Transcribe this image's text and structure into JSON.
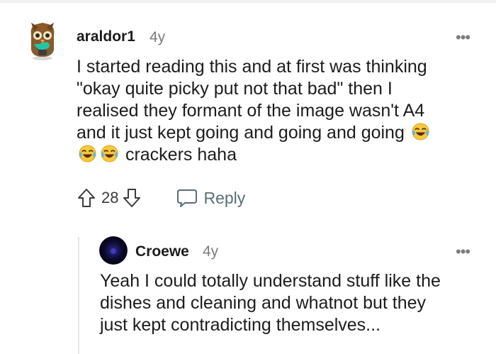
{
  "comments": [
    {
      "username": "araldor1",
      "age": "4y",
      "lines": [
        "I started reading this and at first was thinking",
        "\"okay quite picky put not that bad\" then I",
        "realised they formant of the image wasn't A4",
        "and it just kept going and going and going",
        "crackers haha"
      ],
      "votes": "28",
      "reply_label": "Reply",
      "more_label": "•••"
    },
    {
      "username": "Croewe",
      "age": "4y",
      "lines": [
        "Yeah I could totally understand stuff like the",
        "dishes and cleaning and whatnot but they",
        "just kept contradicting themselves..."
      ],
      "more_label": "•••"
    }
  ],
  "icons": {
    "upvote": "arrow-up-icon",
    "downvote": "arrow-down-icon",
    "reply": "speech-bubble-icon",
    "emoji": "face-with-tears-of-joy-icon"
  },
  "colors": {
    "username": "#1c1c1c",
    "meta": "#7c7c7c",
    "reply": "#576f76",
    "thread_line": "#e5e5e5"
  }
}
